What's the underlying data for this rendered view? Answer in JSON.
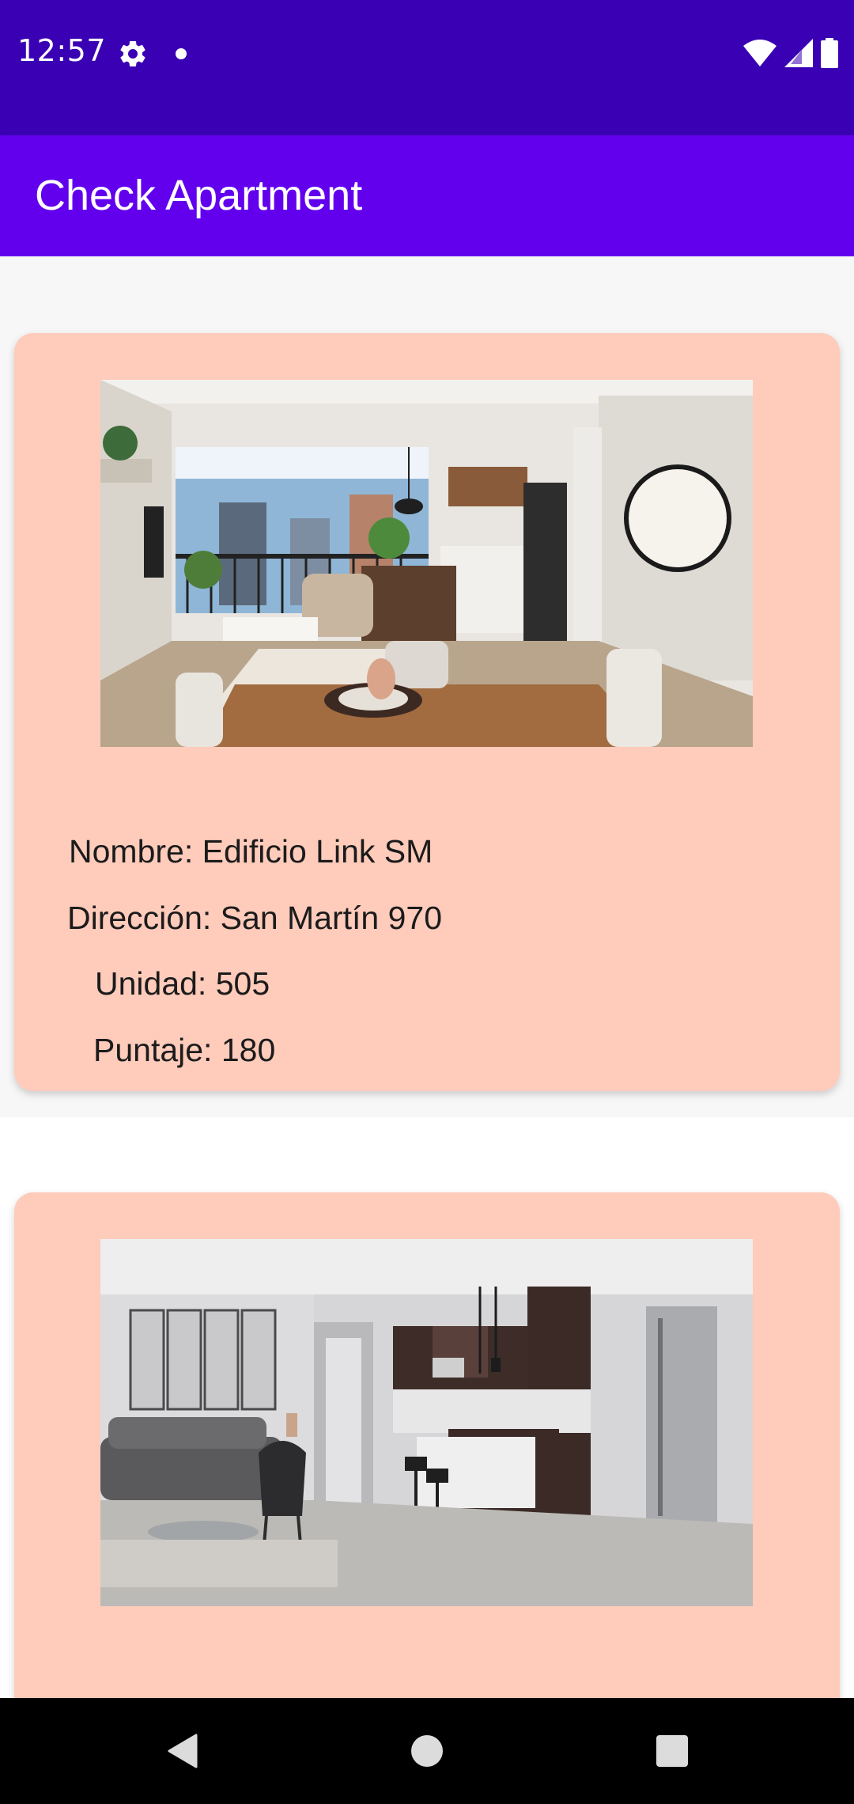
{
  "status_bar": {
    "time": "12:57",
    "icons": [
      "gear-icon",
      "notification-dot-icon",
      "wifi-icon",
      "cell-signal-icon",
      "battery-icon"
    ],
    "background": "#3a00b3"
  },
  "app_bar": {
    "title": "Check Apartment",
    "background": "#6200ee"
  },
  "apartments": [
    {
      "image": "living-room-photo",
      "nombre": "Nombre: Edificio Link SM",
      "direccion": "Dirección: San Martín 970",
      "unidad": "Unidad: 505",
      "puntaje": "Puntaje: 180"
    },
    {
      "image": "kitchen-living-photo"
    }
  ],
  "card_color": "#ffcbbb",
  "nav_bar": {
    "buttons": [
      "back-icon",
      "home-icon",
      "recents-icon"
    ]
  }
}
